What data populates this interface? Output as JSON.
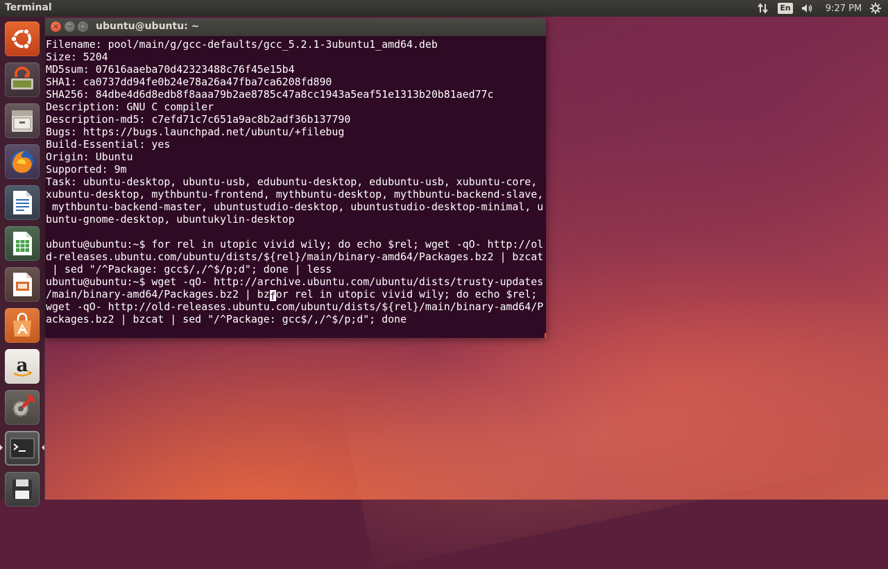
{
  "top_panel": {
    "app_title": "Terminal",
    "keyboard_layout": "En",
    "clock": "9:27 PM",
    "icons": [
      "network-updown-icon",
      "keyboard-layout-icon",
      "volume-icon",
      "system-gear-icon"
    ]
  },
  "launcher": {
    "items": [
      {
        "name": "ubuntu-dash",
        "icon": "ubuntu-logo-icon"
      },
      {
        "name": "software-updater",
        "icon": "software-updater-icon"
      },
      {
        "name": "files",
        "icon": "file-cabinet-icon"
      },
      {
        "name": "firefox",
        "icon": "firefox-icon"
      },
      {
        "name": "libreoffice-writer",
        "icon": "writer-document-icon"
      },
      {
        "name": "libreoffice-calc",
        "icon": "calc-spreadsheet-icon"
      },
      {
        "name": "libreoffice-impress",
        "icon": "impress-presentation-icon"
      },
      {
        "name": "ubuntu-software-center",
        "icon": "software-center-bag-icon"
      },
      {
        "name": "amazon",
        "icon": "amazon-icon"
      },
      {
        "name": "system-settings",
        "icon": "settings-wrench-gear-icon"
      },
      {
        "name": "terminal",
        "icon": "terminal-icon"
      },
      {
        "name": "save-disk",
        "icon": "floppy-disk-icon"
      }
    ]
  },
  "window": {
    "title": "ubuntu@ubuntu: ~",
    "close_glyph": "×",
    "minimize_glyph": "−",
    "maximize_glyph": "□"
  },
  "terminal": {
    "lines": [
      "Filename: pool/main/g/gcc-defaults/gcc_5.2.1-3ubuntu1_amd64.deb",
      "Size: 5204",
      "MD5sum: 07616aaeba70d42323488c76f45e15b4",
      "SHA1: ca0737dd94fe0b24e78a26a47fba7ca6208fd890",
      "SHA256: 84dbe4d6d8edb8f8aaa79b2ae8785c47a8cc1943a5eaf51e1313b20b81aed77c",
      "Description: GNU C compiler",
      "Description-md5: c7efd71c7c651a9ac8b2adf36b137790",
      "Bugs: https://bugs.launchpad.net/ubuntu/+filebug",
      "Build-Essential: yes",
      "Origin: Ubuntu",
      "Supported: 9m",
      "Task: ubuntu-desktop, ubuntu-usb, edubuntu-desktop, edubuntu-usb, xubuntu-core,",
      "xubuntu-desktop, mythbuntu-frontend, mythbuntu-desktop, mythbuntu-backend-slave,",
      " mythbuntu-backend-master, ubuntustudio-desktop, ubuntustudio-desktop-minimal, u",
      "buntu-gnome-desktop, ubuntukylin-desktop",
      "",
      "ubuntu@ubuntu:~$ for rel in utopic vivid wily; do echo $rel; wget -qO- http://ol",
      "d-releases.ubuntu.com/ubuntu/dists/${rel}/main/binary-amd64/Packages.bz2 | bzcat",
      " | sed \"/^Package: gcc$/,/^$/p;d\"; done | less",
      "ubuntu@ubuntu:~$ wget -qO- http://archive.ubuntu.com/ubuntu/dists/trusty-updates",
      "/main/binary-amd64/Packages.bz2 | bz"
    ],
    "cursor_char": "f",
    "cursor_line_rest": "or rel in utopic vivid wily; do echo $rel;",
    "trailing_lines": [
      "wget -qO- http://old-releases.ubuntu.com/ubuntu/dists/${rel}/main/binary-amd64/P",
      "ackages.bz2 | bzcat | sed \"/^Package: gcc$/,/^$/p;d\"; done"
    ]
  },
  "colors": {
    "terminal_bg": "#2f0a24",
    "accent": "#e95420",
    "panel_bg": "#2f2e2b"
  }
}
